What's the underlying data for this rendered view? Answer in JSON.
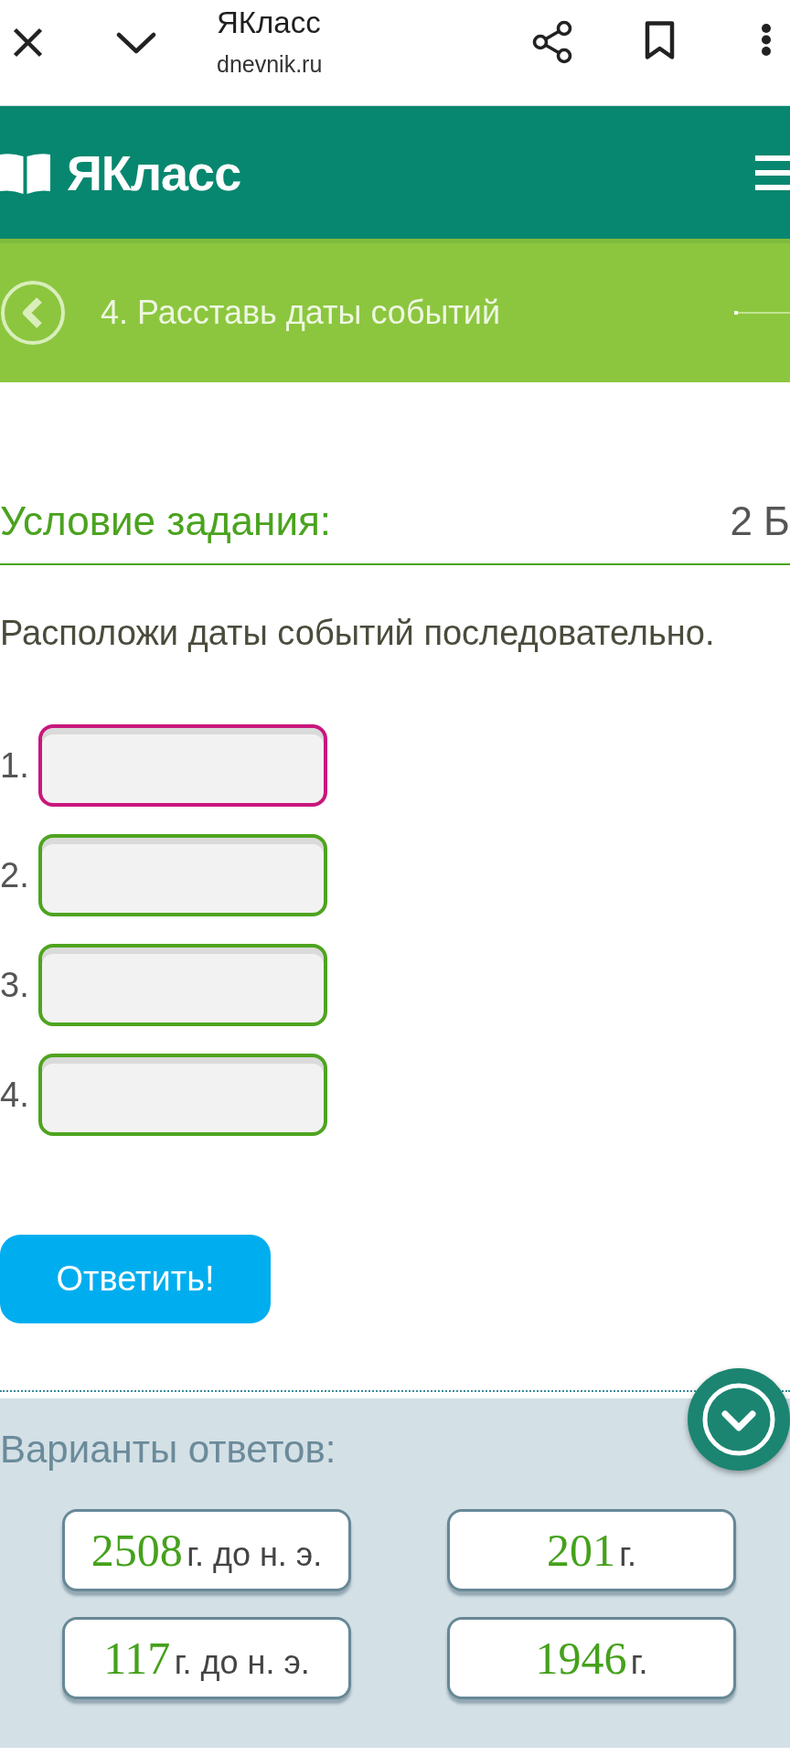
{
  "browser_bar": {
    "title": "ЯКласс",
    "url": "dnevnik.ru"
  },
  "site_header": {
    "logo": "ЯКласс"
  },
  "task_header": {
    "title": "4. Расставь даты событий"
  },
  "task": {
    "heading": "Условие задания:",
    "points": "2 Б",
    "instruction": "Расположи даты событий последовательно.",
    "slots": [
      {
        "label": "1.",
        "selected": true
      },
      {
        "label": "2.",
        "selected": false
      },
      {
        "label": "3.",
        "selected": false
      },
      {
        "label": "4.",
        "selected": false
      }
    ],
    "submit_button": "Ответить!"
  },
  "answer_options": {
    "heading": "Варианты ответов:",
    "options": [
      {
        "number": "2508",
        "unit": "г. до н. э."
      },
      {
        "number": "201",
        "unit": "г."
      },
      {
        "number": "117",
        "unit": "г. до н. э."
      },
      {
        "number": "1946",
        "unit": "г."
      }
    ]
  }
}
